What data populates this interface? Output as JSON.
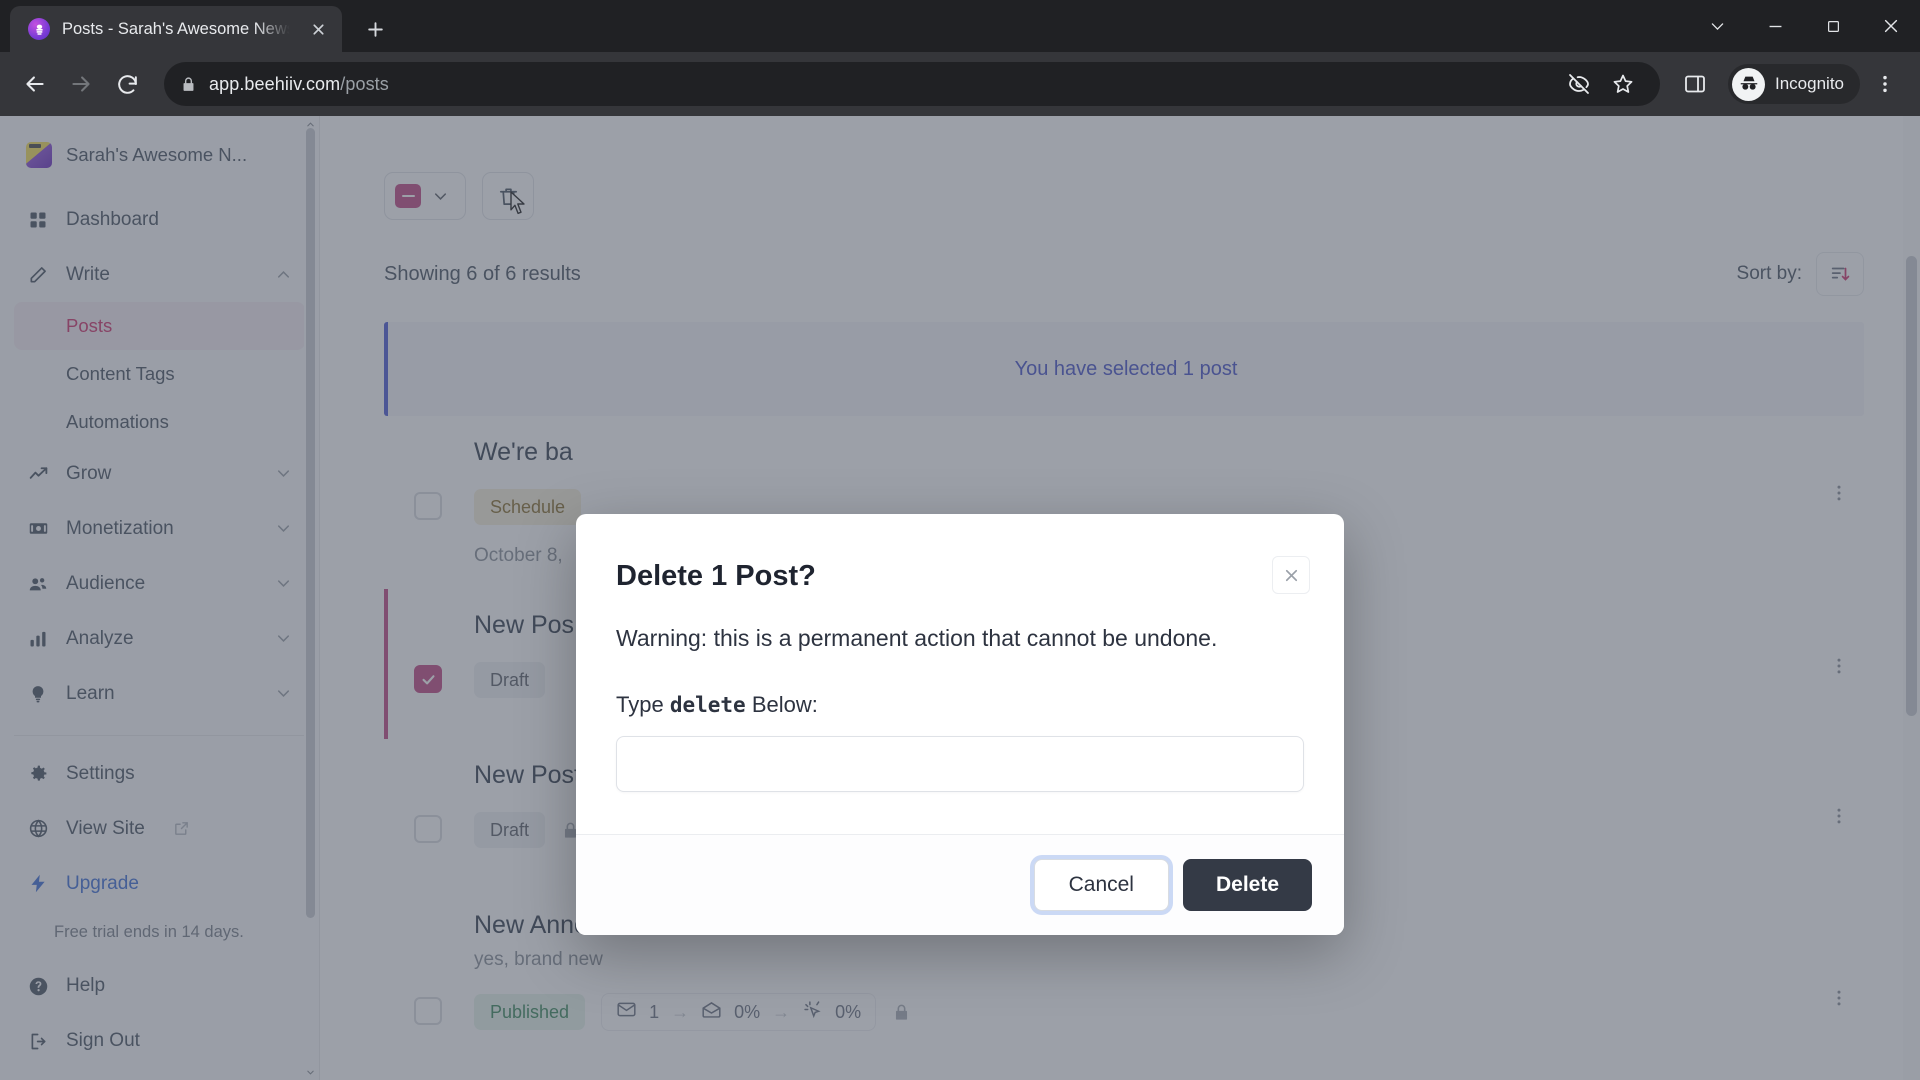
{
  "browser": {
    "tab": {
      "title": "Posts - Sarah's Awesome Newsle",
      "favicon_name": "beehiiv-favicon"
    },
    "new_tab_label": "+",
    "url_host": "app.beehiiv.com",
    "url_path": "/posts",
    "profile_label": "Incognito",
    "window_controls": {
      "minimize": "─",
      "maximize": "□",
      "close": "✕",
      "chevron": "∨"
    }
  },
  "sidebar": {
    "publication": "Sarah's Awesome N...",
    "items": [
      {
        "label": "Dashboard",
        "icon": "grid-icon",
        "expandable": false
      },
      {
        "label": "Write",
        "icon": "pencil-icon",
        "expandable": true,
        "expanded": true
      },
      {
        "label": "Grow",
        "icon": "trending-up-icon",
        "expandable": true
      },
      {
        "label": "Monetization",
        "icon": "money-icon",
        "expandable": true
      },
      {
        "label": "Audience",
        "icon": "people-icon",
        "expandable": true
      },
      {
        "label": "Analyze",
        "icon": "bar-chart-icon",
        "expandable": true
      },
      {
        "label": "Learn",
        "icon": "lightbulb-icon",
        "expandable": true
      }
    ],
    "write_subitems": [
      {
        "label": "Posts",
        "active": true
      },
      {
        "label": "Content Tags",
        "active": false
      },
      {
        "label": "Automations",
        "active": false
      }
    ],
    "bottom_items": [
      {
        "label": "Settings",
        "icon": "gear-icon"
      },
      {
        "label": "View Site",
        "icon": "globe-icon",
        "external": true
      },
      {
        "label": "Upgrade",
        "icon": "lightning-icon",
        "accent": true
      }
    ],
    "trial_notice": "Free trial ends in 14 days.",
    "footer_items": [
      {
        "label": "Help",
        "icon": "question-circle-icon"
      },
      {
        "label": "Sign Out",
        "icon": "sign-out-icon"
      }
    ],
    "active_color": "#d1346d",
    "upgrade_color": "#3f6fd8"
  },
  "main": {
    "bulk_checkbox_state": "indeterminate",
    "results_text": "Showing 6 of 6 results",
    "sort_label": "Sort by:",
    "selection_banner": "You have selected 1 post",
    "posts": [
      {
        "title": "We're ba",
        "subtitle": "",
        "status": "Schedule",
        "status_type": "scheduled",
        "date": "October 8,",
        "selected": false,
        "stats": null
      },
      {
        "title": "New Pos",
        "subtitle": "",
        "status": "Draft",
        "status_type": "draft",
        "date": "",
        "selected": true,
        "stats": null
      },
      {
        "title": "New Post",
        "subtitle": "",
        "status": "Draft",
        "status_type": "draft",
        "date": "",
        "selected": false,
        "stats": null
      },
      {
        "title": "New Announcement",
        "subtitle": "yes, brand new",
        "status": "Published",
        "status_type": "published",
        "date": "",
        "selected": false,
        "stats": {
          "sent": "1",
          "open_rate": "0%",
          "click_rate": "0%"
        }
      }
    ]
  },
  "modal": {
    "title": "Delete 1 Post?",
    "warning": "Warning: this is a permanent action that cannot be undone.",
    "prompt_prefix": "Type",
    "prompt_keyword": "delete",
    "prompt_suffix": "Below:",
    "input_value": "",
    "input_placeholder": "",
    "cancel_label": "Cancel",
    "delete_label": "Delete",
    "close_icon": "close-icon",
    "delete_button_color": "#343a46"
  }
}
